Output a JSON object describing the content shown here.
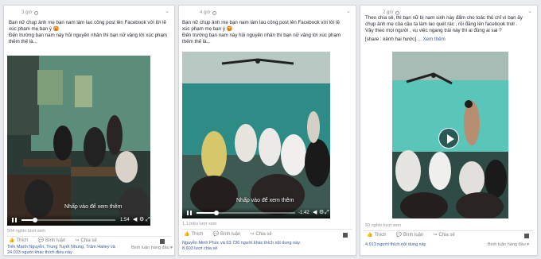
{
  "posts": [
    {
      "time": "3 giờ",
      "text": [
        "Bạn nữ chụp ảnh mẹ bạn nam làm lao công post lên Facebook với lời lẽ",
        "xúc phạm mẹ bạn ý 😡",
        "Đến trường bạn nam này hỏi nguyên nhân thì bạn nữ vâng lời xúc phạm",
        "thêm thế là..."
      ],
      "video": {
        "time": "1:54",
        "cta": "Nhấp vào để xem thêm",
        "progress": 0.12
      },
      "views": "504 nghìn lượt xem",
      "actions": {
        "like": "Thích",
        "comment": "Bình luận",
        "share": "Chia sẻ"
      },
      "sort": "Bình luận hàng đầu ▾",
      "footer": [
        "Tiến Mạnh Nguyễn, Trung Tuyết Nhung, Trâm Hailey và",
        "24.033 người khác thích điều này"
      ]
    },
    {
      "time": "4 giờ",
      "text": [
        "Bạn nữ chụp ảnh mẹ bạn nam làm lao công post lên Facebook với lời lẽ",
        "xúc phạm mẹ bạn ý 😡",
        "Đến trường bạn nam này hỏi nguyên nhân thì bạn nữ vâng lời xúc phạm",
        "thêm thế là..."
      ],
      "video": {
        "time": "-1:42",
        "cta": "Nhấp vào để xem thêm",
        "progress": 0.18
      },
      "views": "1,1 triệu lượt xem",
      "actions": {
        "like": "Thích",
        "comment": "Bình luận",
        "share": "Chia sẻ"
      },
      "footer": [
        "Nguyễn Minh Phúc và 63.736 người khác thích nội dung này.",
        "8.603 lượt chia sẻ"
      ]
    },
    {
      "time": "2 giờ",
      "text": [
        "Theo chia sẻ, thì bạn nữ bị nam sinh này đẩm cho toác thủ chỉ vì bạn ấy",
        "chụp ảnh mẹ của cậu ta làm lao quét rác , rồi đăng lên facebook troll .",
        "Vậy theo mọi người , vụ việc ngang trái này thì ai đúng ai sai ?"
      ],
      "tags": "[share : kênh hai hước]",
      "see_more": "... Xem thêm",
      "views": "50 nghìn lượt xem",
      "actions": {
        "like": "Thích",
        "comment": "Bình luận",
        "share": "Chia sẻ"
      },
      "sort": "Bình luận hàng đầu ▾",
      "footer": [
        "4.913 người thích nội dung này"
      ]
    }
  ],
  "colors": {
    "link": "#365899",
    "meta": "#90949c",
    "bg": "#e9ebee"
  },
  "icons": [
    "globe-icon",
    "chevron-down-icon",
    "pause-icon",
    "volume-icon",
    "settings-icon",
    "fullscreen-icon",
    "play-icon",
    "like-icon",
    "comment-icon",
    "share-icon"
  ]
}
